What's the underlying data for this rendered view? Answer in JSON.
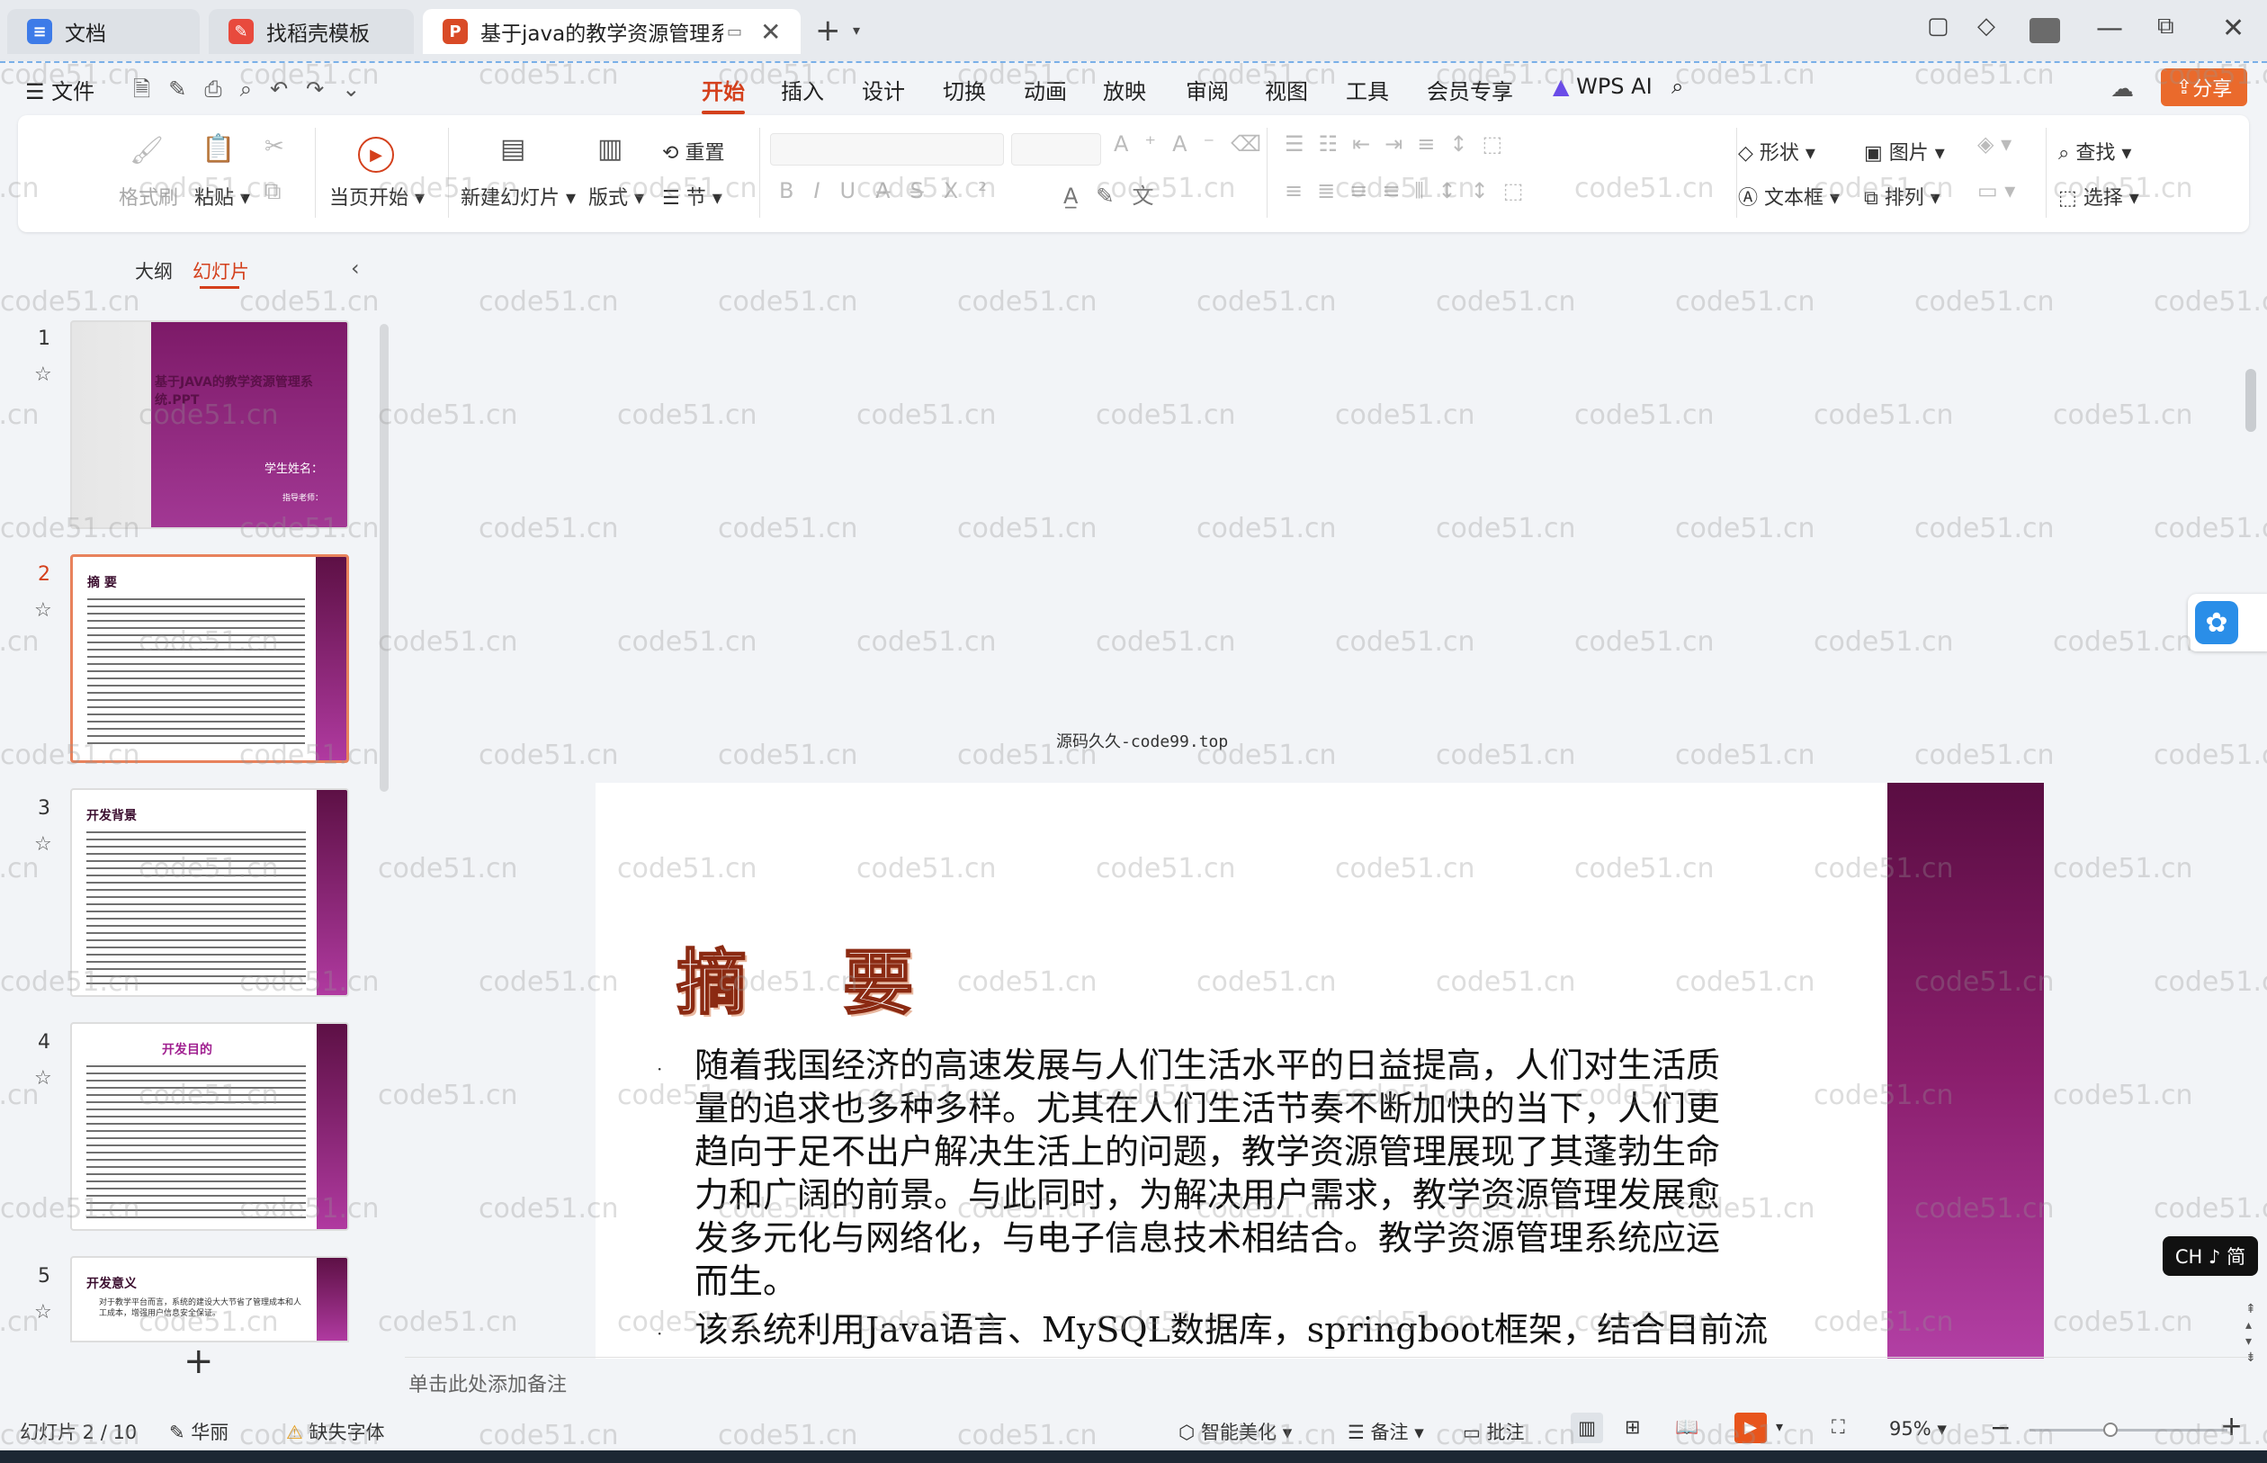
{
  "tabs": [
    {
      "label": "文档",
      "icon": "doc-icon",
      "color": "#3d7be8"
    },
    {
      "label": "找稻壳模板",
      "icon": "docer-icon",
      "color": "#e84a3d"
    },
    {
      "label": "基于java的教学资源管理系统",
      "icon": "ppt-icon",
      "color": "#d94a26"
    }
  ],
  "menu": {
    "file": "文件",
    "items": [
      "开始",
      "插入",
      "设计",
      "切换",
      "动画",
      "放映",
      "审阅",
      "视图",
      "工具",
      "会员专享"
    ],
    "active": "开始",
    "wps_ai": "WPS AI",
    "share": "分享"
  },
  "ribbon": {
    "format_brush": "格式刷",
    "paste": "粘贴",
    "start_from_current": "当页开始",
    "new_slide": "新建幻灯片",
    "layout": "版式",
    "reset": "重置",
    "section": "节",
    "shape": "形状",
    "picture": "图片",
    "textbox": "文本框",
    "arrange": "排列",
    "find": "查找",
    "select": "选择"
  },
  "left_pane": {
    "outline_tab": "大纲",
    "slides_tab": "幻灯片",
    "add_button": "+"
  },
  "thumbnails": [
    {
      "num": "1",
      "title": "基于JAVA的教学资源管理系统.PPT",
      "sub": "学生姓名：",
      "sub2": "指导老师："
    },
    {
      "num": "2",
      "title": "摘 要"
    },
    {
      "num": "3",
      "title": "开发背景"
    },
    {
      "num": "4",
      "title": "开发目的"
    },
    {
      "num": "5",
      "title": "开发意义",
      "text": "对于教学平台而言，系统的建设大大节省了管理成本和人工成本，增强用户信息安全保证。"
    }
  ],
  "canvas": {
    "caption": "源码久久-code99.top"
  },
  "slide": {
    "title": "摘 要",
    "bullets": [
      "随着我国经济的高速发展与人们生活水平的日益提高，人们对生活质量的追求也多种多样。尤其在人们生活节奏不断加快的当下，人们更趋向于足不出户解决生活上的问题，教学资源管理展现了其蓬勃生命力和广阔的前景。与此同时，为解决用户需求，教学资源管理发展愈发多元化与网络化，与电子信息技术相结合。教学资源管理系统应运而生。",
      "该系统利用Java语言、MySQL数据库，springboot框架，结合目前流"
    ]
  },
  "notes": {
    "placeholder": "单击此处添加备注"
  },
  "status": {
    "slide_counter": "幻灯片 2 / 10",
    "theme": "华丽",
    "missing_font": "缺失字体",
    "beautify": "智能美化",
    "notes": "备注",
    "comment": "批注",
    "zoom": "95%"
  },
  "ime": {
    "label": "CH ♪ 简"
  },
  "watermark": "code51.cn"
}
